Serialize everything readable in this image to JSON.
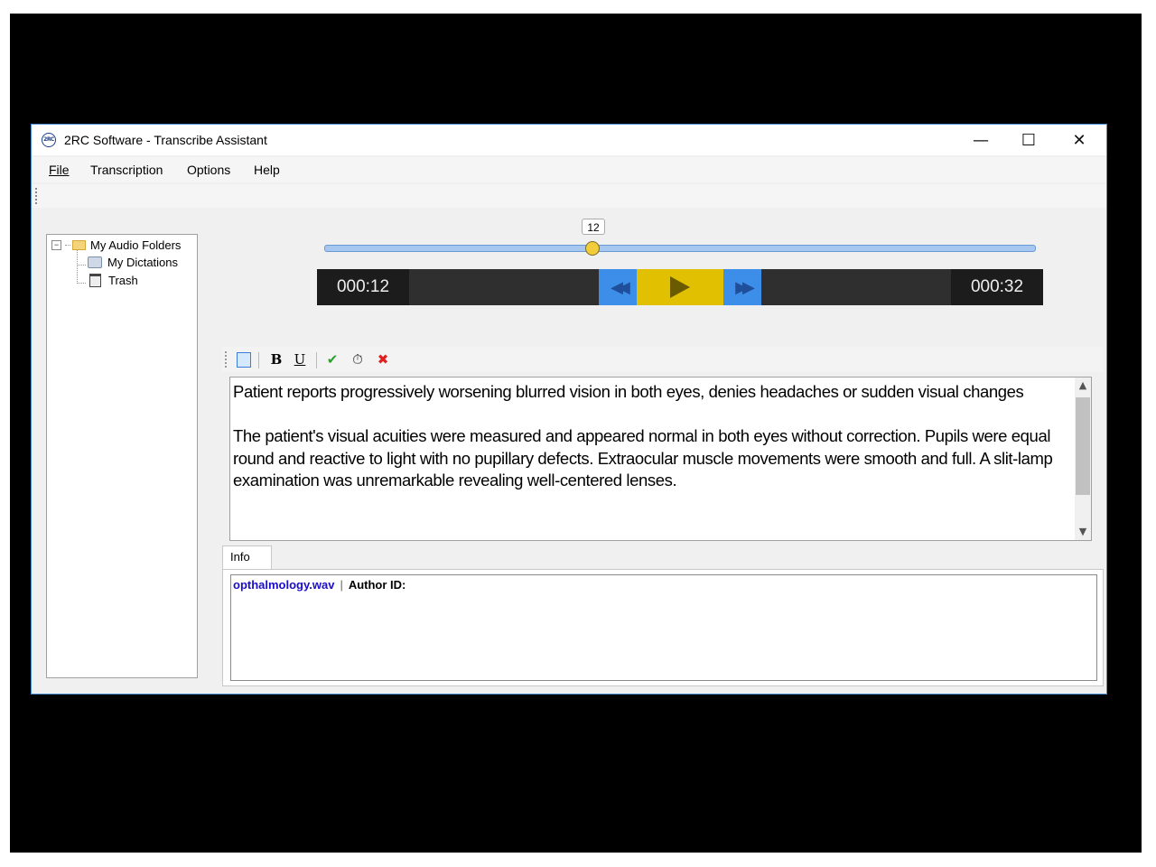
{
  "window": {
    "title": "2RC Software - Transcribe Assistant",
    "logo_text": "2RC"
  },
  "window_controls": {
    "minimize": "—",
    "maximize": "☐",
    "close": "✕"
  },
  "menu": [
    "File",
    "Transcription",
    "Options",
    "Help"
  ],
  "tree": {
    "root": "My Audio Folders",
    "dictations": "My Dictations",
    "trash": "Trash",
    "root_toggle": "−"
  },
  "player": {
    "position_label": "12",
    "position_fraction": 0.375,
    "current_time": "000:12",
    "total_time": "000:32",
    "rewind_icon": "◀◀",
    "forward_icon": "▶▶"
  },
  "edit_toolbar": {
    "bold": "B",
    "underline": "U",
    "check": "✔",
    "timer": "⏱",
    "cancel": "✖"
  },
  "editor": {
    "paragraph1": "Patient reports progressively worsening blurred vision in both eyes, denies headaches or sudden visual changes",
    "paragraph2": "The patient's visual acuities were measured and appeared normal in both eyes without correction. Pupils were equal round and reactive to light with no pupillary defects. Extraocular muscle movements were smooth and full. A slit-lamp examination was unremarkable revealing well-centered lenses."
  },
  "info": {
    "tab_label": "Info",
    "filename": "opthalmology.wav",
    "separator": "|",
    "author_label": "Author ID:"
  },
  "colors": {
    "player_blue": "#3c8ee8",
    "player_yellow": "#e0c000",
    "link_blue": "#1a0dcc"
  }
}
